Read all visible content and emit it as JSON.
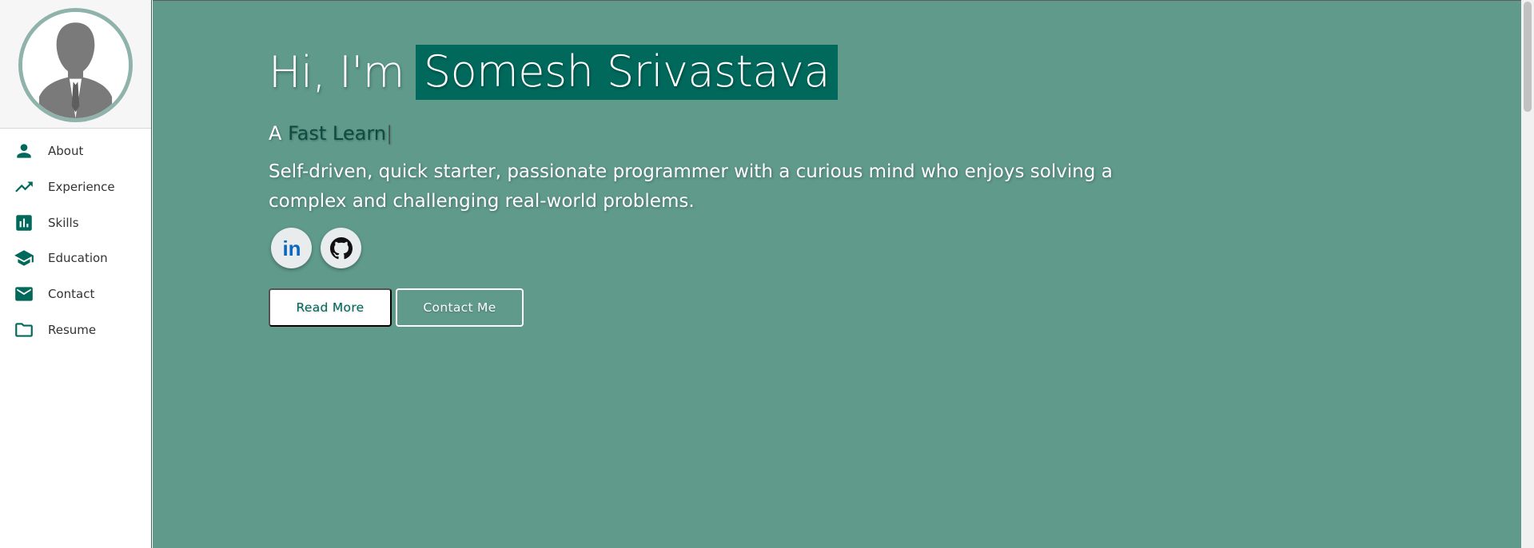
{
  "sidebar": {
    "avatar_alt": "profile-avatar",
    "items": [
      {
        "label": "About",
        "icon": "person-icon"
      },
      {
        "label": "Experience",
        "icon": "trending-up-icon"
      },
      {
        "label": "Skills",
        "icon": "bar-chart-icon"
      },
      {
        "label": "Education",
        "icon": "school-icon"
      },
      {
        "label": "Contact",
        "icon": "mail-icon"
      },
      {
        "label": "Resume",
        "icon": "folder-icon"
      }
    ]
  },
  "hero": {
    "greeting_prefix": "Hi, I'm",
    "name": "Somesh Srivastava",
    "role_prefix": "A",
    "role_typed": "Fast Learn",
    "caret": "|",
    "tagline": "Self-driven, quick starter, passionate programmer with a curious mind who enjoys solving a complex and challenging real-world problems.",
    "socials": [
      {
        "name": "linkedin",
        "icon": "linkedin-icon",
        "text": "in"
      },
      {
        "name": "github",
        "icon": "github-icon"
      }
    ],
    "read_more_label": "Read More",
    "contact_me_label": "Contact Me"
  },
  "colors": {
    "accent": "#00695c",
    "hero_background": "#5f9a8b",
    "sidebar_background": "#ffffff",
    "avatar_border": "#8fb3aa",
    "linkedin_blue": "#0a66c2"
  }
}
